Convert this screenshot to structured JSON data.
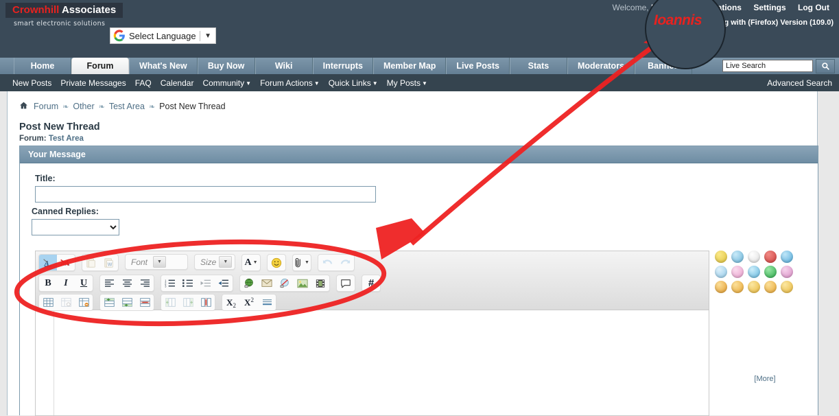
{
  "header": {
    "brand_first": "Crownhill",
    "brand_second": "Associates",
    "tagline": "smart electronic solutions",
    "translate_label": "Select Language",
    "translate_caret": "▼",
    "welcome_label": "Welcome,",
    "username": "Ioannis",
    "notifications": "Notifications",
    "settings": "Settings",
    "logout": "Log Out",
    "browser_line": "ng with (Firefox) Version (109.0)"
  },
  "nav": {
    "tabs": [
      {
        "label": "Home",
        "active": false
      },
      {
        "label": "Forum",
        "active": true
      },
      {
        "label": "What's New",
        "active": false
      },
      {
        "label": "Buy Now",
        "active": false
      },
      {
        "label": "Wiki",
        "active": false
      },
      {
        "label": "Interrupts",
        "active": false
      },
      {
        "label": "Member Map",
        "active": false
      },
      {
        "label": "Live Posts",
        "active": false
      },
      {
        "label": "Stats",
        "active": false
      },
      {
        "label": "Moderators",
        "active": false
      },
      {
        "label": "Banned",
        "active": false
      }
    ],
    "search_value": "Live Search",
    "search_icon": "magnifier-icon"
  },
  "subnav": {
    "items": [
      {
        "label": "New Posts",
        "caret": false
      },
      {
        "label": "Private Messages",
        "caret": false
      },
      {
        "label": "FAQ",
        "caret": false
      },
      {
        "label": "Calendar",
        "caret": false
      },
      {
        "label": "Community",
        "caret": true
      },
      {
        "label": "Forum Actions",
        "caret": true
      },
      {
        "label": "Quick Links",
        "caret": true
      },
      {
        "label": "My Posts",
        "caret": true
      }
    ],
    "advanced_search": "Advanced Search"
  },
  "breadcrumb": {
    "home_icon": "home-icon",
    "items": [
      "Forum",
      "Other",
      "Test Area"
    ],
    "current": "Post New Thread",
    "separator": "❧"
  },
  "page": {
    "title": "Post New Thread",
    "forum_prefix": "Forum:",
    "forum_name": "Test Area",
    "panel_header": "Your Message",
    "title_label": "Title:",
    "title_value": "",
    "title_placeholder": "",
    "canned_label": "Canned Replies:",
    "canned_selected": "",
    "canned_options": [
      ""
    ]
  },
  "editor": {
    "toolbar_rows": [
      {
        "groups": [
          {
            "buttons": [
              {
                "name": "remove-formatting-icon",
                "glyph": "A",
                "state": "on"
              },
              {
                "name": "strip-font-styles-icon",
                "glyph": "4A",
                "state": "normal"
              }
            ]
          },
          {
            "buttons": [
              {
                "name": "paste-icon",
                "glyph": "📋",
                "state": "dim"
              },
              {
                "name": "paste-from-word-icon",
                "glyph": "📄",
                "state": "dim"
              }
            ]
          },
          {
            "select": {
              "name": "font-family-select",
              "label": "Font",
              "caret": "▾"
            }
          },
          {
            "select": {
              "name": "font-size-select",
              "label": "Size",
              "caret": "▾"
            }
          },
          {
            "buttons": [
              {
                "name": "font-color-icon",
                "glyph": "A",
                "state": "caret"
              }
            ]
          },
          {
            "buttons": [
              {
                "name": "smilies-icon",
                "glyph": "☺",
                "state": "normal"
              }
            ]
          },
          {
            "buttons": [
              {
                "name": "attachment-icon",
                "glyph": "🗇",
                "state": "caret"
              }
            ]
          },
          {
            "buttons": [
              {
                "name": "undo-icon",
                "glyph": "↩",
                "state": "dim"
              },
              {
                "name": "redo-icon",
                "glyph": "↪",
                "state": "dim"
              }
            ]
          }
        ]
      },
      {
        "groups": [
          {
            "buttons": [
              {
                "name": "bold-icon",
                "glyph": "B",
                "state": "normal"
              },
              {
                "name": "italic-icon",
                "glyph": "I",
                "state": "normal"
              },
              {
                "name": "underline-icon",
                "glyph": "U",
                "state": "normal"
              }
            ]
          },
          {
            "buttons": [
              {
                "name": "align-left-icon",
                "glyph": "≡",
                "state": "normal"
              },
              {
                "name": "align-center-icon",
                "glyph": "≡",
                "state": "normal"
              },
              {
                "name": "align-right-icon",
                "glyph": "≡",
                "state": "normal"
              }
            ]
          },
          {
            "buttons": [
              {
                "name": "ordered-list-icon",
                "glyph": "≔",
                "state": "normal"
              },
              {
                "name": "unordered-list-icon",
                "glyph": "≔",
                "state": "normal"
              },
              {
                "name": "outdent-icon",
                "glyph": "⇤",
                "state": "dim"
              },
              {
                "name": "indent-icon",
                "glyph": "⇥",
                "state": "normal"
              }
            ]
          },
          {
            "buttons": [
              {
                "name": "insert-link-icon",
                "glyph": "🌐",
                "state": "normal"
              },
              {
                "name": "insert-email-icon",
                "glyph": "✉",
                "state": "normal"
              },
              {
                "name": "remove-link-icon",
                "glyph": "🌐",
                "state": "normal"
              },
              {
                "name": "insert-image-icon",
                "glyph": "🖼",
                "state": "normal"
              },
              {
                "name": "insert-video-icon",
                "glyph": "🎞",
                "state": "normal"
              }
            ]
          },
          {
            "buttons": [
              {
                "name": "quote-icon",
                "glyph": "💬",
                "state": "normal"
              }
            ]
          },
          {
            "buttons": [
              {
                "name": "code-icon",
                "glyph": "#",
                "state": "normal"
              }
            ]
          }
        ]
      },
      {
        "groups": [
          {
            "buttons": [
              {
                "name": "insert-table-icon",
                "glyph": "▦",
                "state": "normal"
              },
              {
                "name": "table-properties-icon",
                "glyph": "▦",
                "state": "dim"
              },
              {
                "name": "delete-table-icon",
                "glyph": "▦",
                "state": "normal"
              }
            ]
          },
          {
            "buttons": [
              {
                "name": "insert-row-before-icon",
                "glyph": "▤",
                "state": "normal"
              },
              {
                "name": "insert-row-after-icon",
                "glyph": "▤",
                "state": "normal"
              },
              {
                "name": "delete-row-icon",
                "glyph": "▤",
                "state": "normal"
              }
            ]
          },
          {
            "buttons": [
              {
                "name": "insert-column-before-icon",
                "glyph": "▥",
                "state": "dim"
              },
              {
                "name": "insert-column-after-icon",
                "glyph": "▥",
                "state": "dim"
              },
              {
                "name": "delete-column-icon",
                "glyph": "▥",
                "state": "normal"
              }
            ]
          },
          {
            "buttons": [
              {
                "name": "subscript-icon",
                "glyph": "X₂",
                "state": "normal"
              },
              {
                "name": "superscript-icon",
                "glyph": "X²",
                "state": "normal"
              },
              {
                "name": "horizontal-rule-icon",
                "glyph": "≡",
                "state": "normal"
              }
            ]
          }
        ]
      }
    ],
    "body_value": ""
  },
  "smilies": {
    "more_label": "[More]",
    "rows": [
      [
        {
          "name": "smiley-happy",
          "color": "#e8cf4a",
          "mouth": "smile",
          "eyes": "dots"
        },
        {
          "name": "smiley-confused",
          "color": "#7fc6e8",
          "mouth": "flat",
          "eyes": "dots"
        },
        {
          "name": "smiley-shocked",
          "color": "#ffffff",
          "mouth": "open",
          "eyes": "big"
        },
        {
          "name": "smiley-angry",
          "color": "#e04a48",
          "mouth": "frown",
          "eyes": "dots"
        },
        {
          "name": "smiley-wink-blue",
          "color": "#6ec2ea",
          "mouth": "smile",
          "eyes": "wink"
        }
      ],
      [
        {
          "name": "smiley-cool",
          "color": "#9dd4f2",
          "mouth": "smile",
          "eyes": "shades"
        },
        {
          "name": "smiley-tongue-pink",
          "color": "#f0b8d8",
          "mouth": "tongue",
          "eyes": "dots"
        },
        {
          "name": "smiley-wink",
          "color": "#7fc6e8",
          "mouth": "smile",
          "eyes": "wink"
        },
        {
          "name": "smiley-grin-green",
          "color": "#4ec46a",
          "mouth": "teeth",
          "eyes": "dots"
        },
        {
          "name": "smiley-blush",
          "color": "#e6a6d4",
          "mouth": "smile",
          "eyes": "dots"
        }
      ],
      [
        {
          "name": "smiley-smirk",
          "color": "#f0a93a",
          "mouth": "teeth",
          "eyes": "closed"
        },
        {
          "name": "smiley-laugh",
          "color": "#f2b13f",
          "mouth": "teeth",
          "eyes": "dots"
        },
        {
          "name": "smiley-sad",
          "color": "#f2c04a",
          "mouth": "frown",
          "eyes": "dots"
        },
        {
          "name": "smiley-tongue",
          "color": "#f2b13f",
          "mouth": "tongue",
          "eyes": "dots"
        },
        {
          "name": "smiley-content",
          "color": "#f2c04a",
          "mouth": "smile",
          "eyes": "dots"
        }
      ]
    ]
  },
  "annotation": {
    "circle_username": "Ioannis",
    "accent_color": "#ee2222"
  }
}
